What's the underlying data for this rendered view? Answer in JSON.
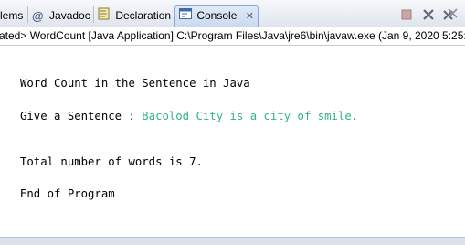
{
  "tabs": [
    {
      "label": "lems",
      "icon": "problems-icon"
    },
    {
      "label": "Javadoc",
      "icon": "at-icon"
    },
    {
      "label": "Declaration",
      "icon": "declaration-icon"
    },
    {
      "label": "Console",
      "icon": "console-icon",
      "active": true,
      "close": "✕"
    }
  ],
  "toolbar": {
    "icons": [
      "terminate-icon",
      "remove-launch-icon",
      "remove-all-terminated-icon"
    ]
  },
  "status_line": "ated> WordCount [Java Application] C:\\Program Files\\Java\\jre6\\bin\\javaw.exe (Jan 9, 2020 5:25:10",
  "console": {
    "line1": "Word Count in the Sentence in Java",
    "prompt": "Give a Sentence : ",
    "user_input": "Bacolod City is a city of smile.",
    "result": "Total number of words is 7.",
    "end": "End of Program"
  },
  "colors": {
    "input_text": "#32b28f",
    "active_tab": "#cad8ef"
  }
}
